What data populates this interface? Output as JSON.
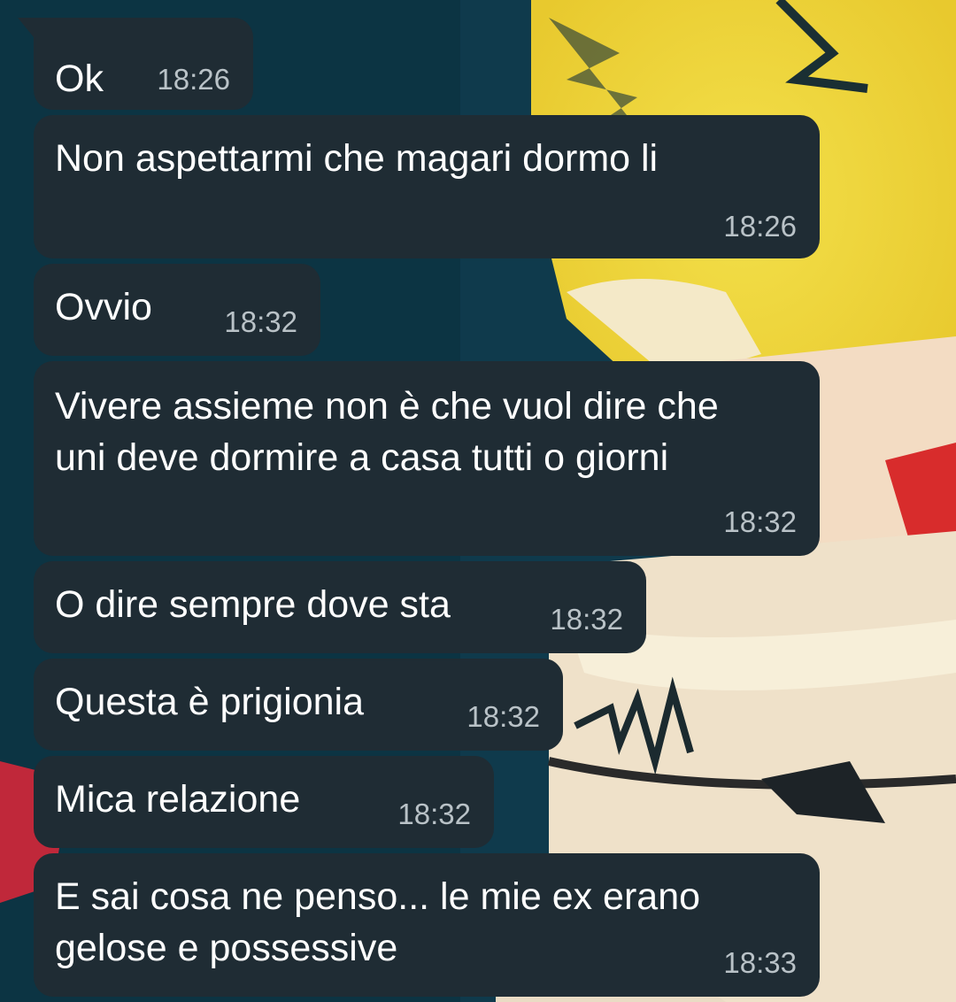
{
  "chat": {
    "messages": [
      {
        "text": "Ok",
        "time": "18:26"
      },
      {
        "text": "Non aspettarmi che magari dormo li",
        "time": "18:26"
      },
      {
        "text": "Ovvio",
        "time": "18:32"
      },
      {
        "text": "Vivere assieme non è che vuol dire che\nuni deve dormire a casa tutti o giorni",
        "time": "18:32"
      },
      {
        "text": "O dire sempre dove sta",
        "time": "18:32"
      },
      {
        "text": "Questa è prigionia",
        "time": "18:32"
      },
      {
        "text": "Mica relazione",
        "time": "18:32"
      },
      {
        "text": "E sai cosa ne penso... le mie ex erano\ngelose e possessive",
        "time": "18:33"
      }
    ]
  },
  "colors": {
    "bubble": "#1f2c34",
    "text": "#ffffff",
    "timestamp": "#b9c2c7",
    "wallpaper_base": "#0f3a4c",
    "wallpaper_yellow": "#efd93a"
  }
}
